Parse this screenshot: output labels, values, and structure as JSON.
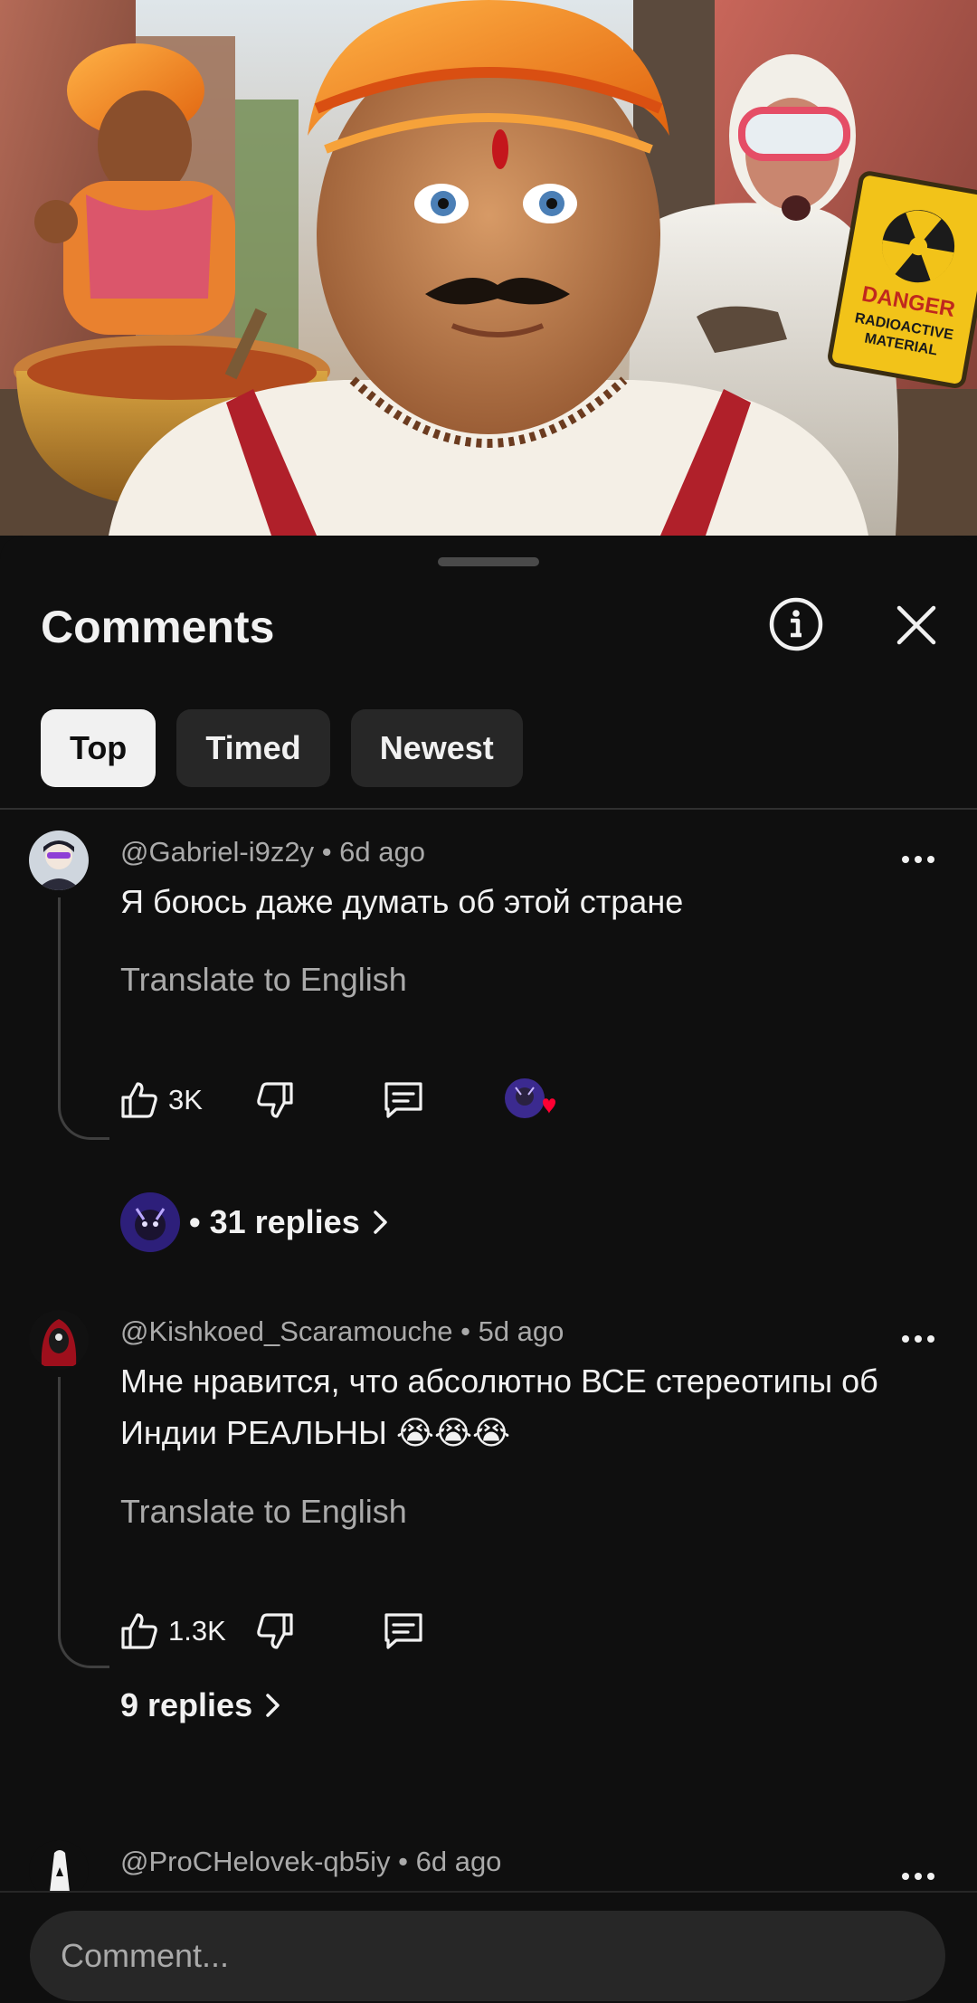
{
  "video": {
    "thumbnail_sign_line1": "DANGER",
    "thumbnail_sign_line2": "RADIOACTIVE",
    "thumbnail_sign_line3": "MATERIAL"
  },
  "comments_panel": {
    "title": "Comments",
    "info_icon": "info-circle-icon",
    "close_icon": "close-x-icon",
    "tabs": [
      {
        "label": "Top",
        "active": true
      },
      {
        "label": "Timed",
        "active": false
      },
      {
        "label": "Newest",
        "active": false
      }
    ]
  },
  "comments": [
    {
      "author": "@Gabriel-i9z2y",
      "age": "6d ago",
      "meta": "@Gabriel-i9z2y • 6d ago",
      "text": "Я боюсь даже думать об этой стране",
      "translate": "Translate to English",
      "likes": "3K",
      "creator_hearted": true,
      "replies": "• 31 replies"
    },
    {
      "author": "@Kishkoed_Scaramouche",
      "age": "5d ago",
      "meta": "@Kishkoed_Scaramouche • 5d ago",
      "text": "Мне нравится, что абсолютно ВСЕ стереотипы об Индии РЕАЛЬНЫ 😭😭😭",
      "translate": "Translate to English",
      "likes": "1.3K",
      "creator_hearted": false,
      "replies": "9 replies"
    },
    {
      "author": "@ProCHelovek-qb5iy",
      "age": "6d ago",
      "meta": "@ProCHelovek-qb5iy • 6d ago"
    }
  ],
  "composer": {
    "placeholder": "Comment..."
  },
  "colors": {
    "background": "#0f0f0f",
    "chip": "#272727",
    "chip_active": "#f1f1f1",
    "secondary_text": "#aaaaaa",
    "heart": "#ff0033"
  }
}
